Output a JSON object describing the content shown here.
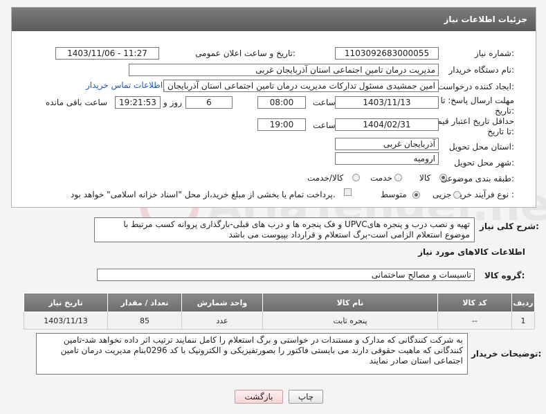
{
  "header": {
    "title": "جزئیات اطلاعات نیاز"
  },
  "form": {
    "need_number_label": "شماره نیاز:",
    "need_number": "1103092683000055",
    "announce_label": "تاریخ و ساعت اعلان عمومی:",
    "announce_value": "1403/11/06 - 11:27",
    "buyer_org_label": "نام دستگاه خریدار:",
    "buyer_org": "مدیریت درمان تامین اجتماعی استان آذربایجان غربی",
    "creator_label": "ایجاد کننده درخواست:",
    "creator": "امین جمشیدی مسئول تدارکات مدیریت درمان تامین اجتماعی استان آذربایجان غ",
    "contact_link": "اطلاعات تماس خریدار",
    "deadline_label": "مهلت ارسال پاسخ: تا تاریخ:",
    "deadline_date": "1403/11/13",
    "time_label": "ساعت",
    "deadline_time": "08:00",
    "days_value": "6",
    "days_label": "روز و",
    "remaining_time": "19:21:53",
    "remaining_label": "ساعت باقی مانده",
    "validity_label": "حداقل تاریخ اعتبار قیمت: تا تاریخ:",
    "validity_date": "1404/02/31",
    "validity_time": "19:00",
    "province_label": "استان محل تحویل:",
    "province": "آذربایجان غربی",
    "city_label": "شهر محل تحویل:",
    "city": "ارومیه",
    "category_label": "طبقه بندی موضوعی:",
    "category_options": [
      "کالا",
      "خدمت",
      "کالا/خدمت"
    ],
    "purchase_type_label": "نوع فرآیند خرید :",
    "purchase_options": [
      "جزیی",
      "متوسط"
    ],
    "payment_note": "پرداخت تمام یا بخشی از مبلغ خرید،از محل \"اسناد خزانه اسلامی\" خواهد بود."
  },
  "description": {
    "label": "شرح کلی نیاز:",
    "text": "تهیه و نصب درب و پنجره هایUPVC و فک پنجره ها و درب های قبلی-بارگذاری پروانه کسب مرتبط با موضوع استعلام الزامی است-برگ استعلام و قرارداد بپیوست می باشد"
  },
  "goods_section": {
    "title": "اطلاعات کالاهای مورد نیاز",
    "group_label": "گروه کالا:",
    "group_value": "تاسیسات و مصالح ساختمانی",
    "headers": [
      "ردیف",
      "کد کالا",
      "نام کالا",
      "واحد شمارش",
      "تعداد / مقدار",
      "تاریخ نیاز"
    ],
    "rows": [
      [
        "1",
        "--",
        "پنجره ثابت",
        "عدد",
        "85",
        "1403/11/13"
      ]
    ]
  },
  "buyer_notes": {
    "label": "توضیحات خریدار:",
    "text": "به شرکت کنندگانی که مدارک و مستندات در خواستی و برگ استعلام را کامل ننمایند ترتیب اثر داده نخواهد شد-تامین کنندگانی که ماهیت حقوقی دارند می بایستی فاکتور را بصورتفیزیکی و الکترونیک با کد 0296بنام مدیریت درمان تامین اجتماعی استان صادر نمایند"
  },
  "buttons": {
    "print": "چاپ",
    "back": "بازگشت"
  },
  "watermark": "AriaTender.neT",
  "colors": {
    "header": "#6a6a6a",
    "link": "#1a5ab8",
    "back_button": "#f5d6d6"
  }
}
